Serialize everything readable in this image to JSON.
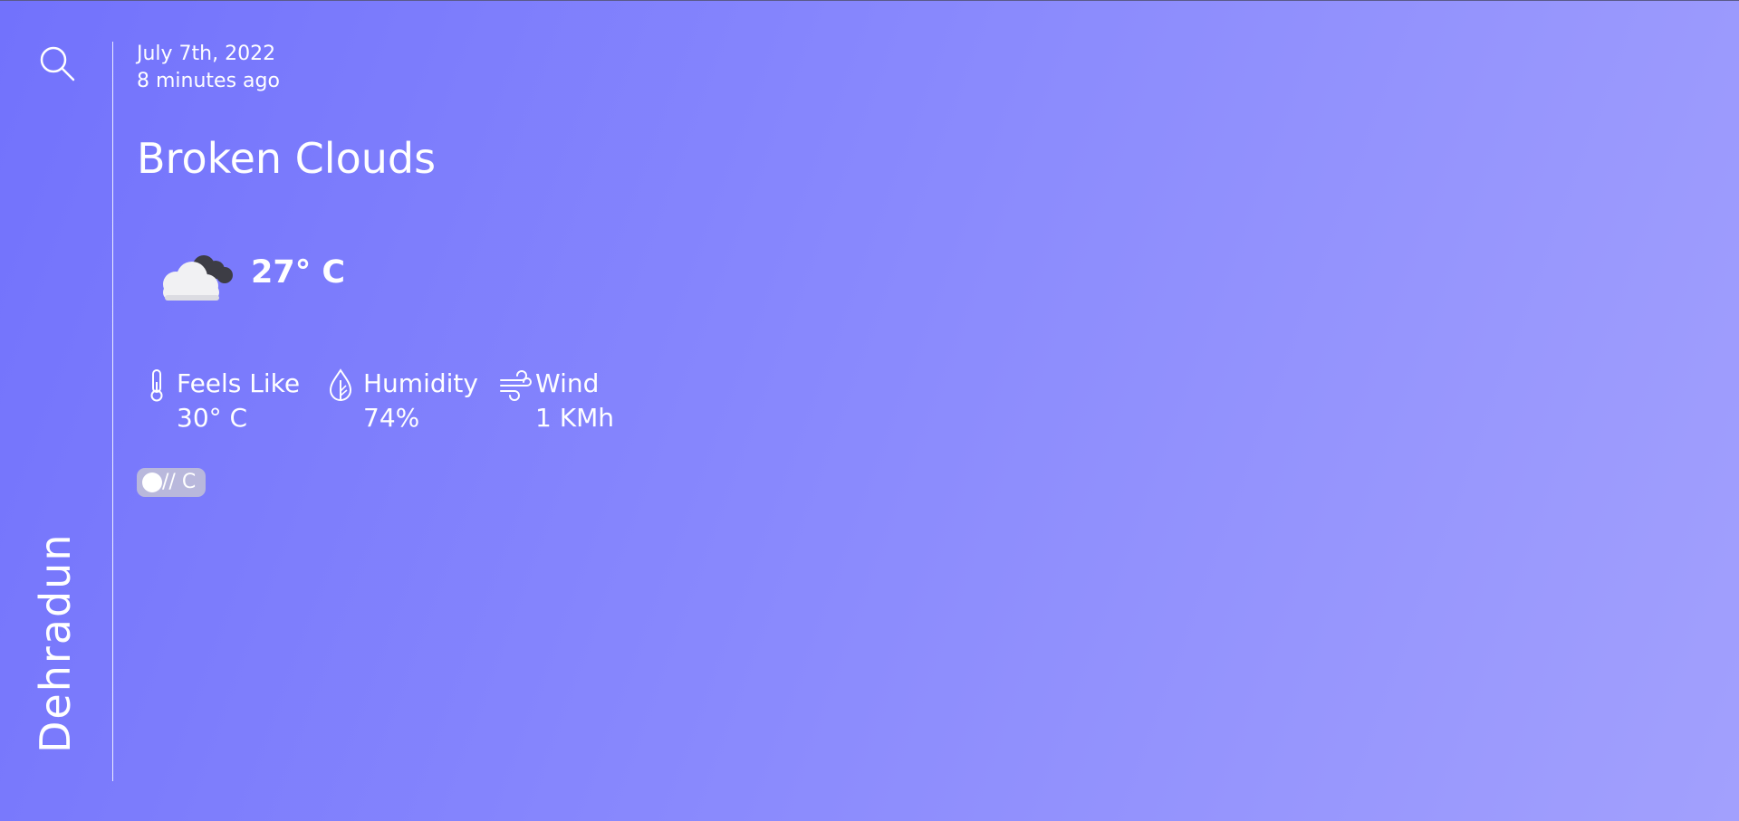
{
  "location": {
    "city": "Dehradun"
  },
  "weather": {
    "date": "July 7th, 2022",
    "updated": "8 minutes ago",
    "condition": "Broken Clouds",
    "icon": "broken-clouds-icon",
    "temperature": "27° C"
  },
  "stats": [
    {
      "icon": "thermometer-icon",
      "label": "Feels Like",
      "value": "30° C"
    },
    {
      "icon": "droplet-leaf-icon",
      "label": "Humidity",
      "value": "74%"
    },
    {
      "icon": "wind-icon",
      "label": "Wind",
      "value": "1 KMh"
    }
  ],
  "unit_toggle": {
    "label": "// C"
  },
  "colors": {
    "background_start": "#7272fc",
    "background_end": "#a2a0fd",
    "text": "#ffffff",
    "toggle_track": "#b9b8dc"
  }
}
